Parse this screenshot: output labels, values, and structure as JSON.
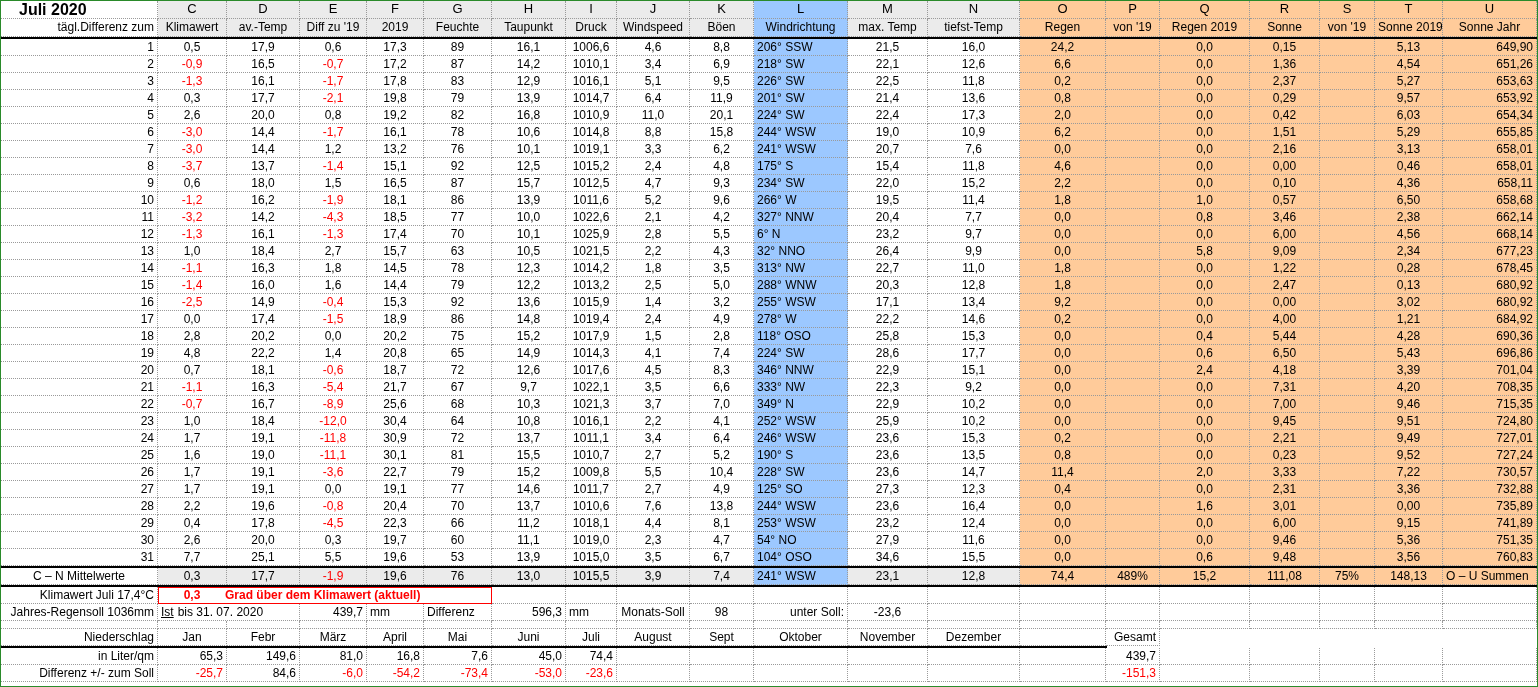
{
  "title": "Juli 2020",
  "column_letters": [
    "C",
    "D",
    "E",
    "F",
    "G",
    "H",
    "I",
    "J",
    "K",
    "L",
    "M",
    "N",
    "O",
    "P",
    "Q",
    "R",
    "S",
    "T",
    "U"
  ],
  "row_header_label": "tägl.Differenz zum",
  "column_headers": [
    "Klimawert",
    "av.-Temp",
    "Diff zu '19",
    "2019",
    "Feuchte",
    "Taupunkt",
    "Druck",
    "Windspeed",
    "Böen",
    "Windrichtung",
    "max. Temp",
    "tiefst-Temp",
    "Regen",
    "von '19",
    "Regen 2019",
    "Sonne",
    "von '19",
    "Sonne 2019",
    "Sonne Jahr"
  ],
  "rows": [
    {
      "day": "1",
      "cells": [
        "0,5",
        "17,9",
        "0,6",
        "17,3",
        "89",
        "16,1",
        "1006,6",
        "4,6",
        "8,8",
        "206° SSW",
        "21,5",
        "16,0",
        "24,2",
        null,
        "0,0",
        "0,15",
        null,
        "5,13",
        "649,90"
      ],
      "red_c": false,
      "red_e": false
    },
    {
      "day": "2",
      "cells": [
        "-0,9",
        "16,5",
        "-0,7",
        "17,2",
        "87",
        "14,2",
        "1010,1",
        "3,4",
        "6,9",
        "218° SW",
        "22,1",
        "12,6",
        "6,6",
        null,
        "0,0",
        "1,36",
        null,
        "4,54",
        "651,26"
      ],
      "red_c": true,
      "red_e": true
    },
    {
      "day": "3",
      "cells": [
        "-1,3",
        "16,1",
        "-1,7",
        "17,8",
        "83",
        "12,9",
        "1016,1",
        "5,1",
        "9,5",
        "226° SW",
        "22,5",
        "11,8",
        "0,2",
        null,
        "0,0",
        "2,37",
        null,
        "5,27",
        "653,63"
      ],
      "red_c": true,
      "red_e": true
    },
    {
      "day": "4",
      "cells": [
        "0,3",
        "17,7",
        "-2,1",
        "19,8",
        "79",
        "13,9",
        "1014,7",
        "6,4",
        "11,9",
        "201° SW",
        "21,4",
        "13,6",
        "0,8",
        null,
        "0,0",
        "0,29",
        null,
        "9,57",
        "653,92"
      ],
      "red_c": false,
      "red_e": true
    },
    {
      "day": "5",
      "cells": [
        "2,6",
        "20,0",
        "0,8",
        "19,2",
        "82",
        "16,8",
        "1010,9",
        "11,0",
        "20,1",
        "224° SW",
        "22,4",
        "17,3",
        "2,0",
        null,
        "0,0",
        "0,42",
        null,
        "6,03",
        "654,34"
      ],
      "red_c": false,
      "red_e": false
    },
    {
      "day": "6",
      "cells": [
        "-3,0",
        "14,4",
        "-1,7",
        "16,1",
        "78",
        "10,6",
        "1014,8",
        "8,8",
        "15,8",
        "244° WSW",
        "19,0",
        "10,9",
        "6,2",
        null,
        "0,0",
        "1,51",
        null,
        "5,29",
        "655,85"
      ],
      "red_c": true,
      "red_e": true
    },
    {
      "day": "7",
      "cells": [
        "-3,0",
        "14,4",
        "1,2",
        "13,2",
        "76",
        "10,1",
        "1019,1",
        "3,3",
        "6,2",
        "241° WSW",
        "20,7",
        "7,6",
        "0,0",
        null,
        "0,0",
        "2,16",
        null,
        "3,13",
        "658,01"
      ],
      "red_c": true,
      "red_e": false
    },
    {
      "day": "8",
      "cells": [
        "-3,7",
        "13,7",
        "-1,4",
        "15,1",
        "92",
        "12,5",
        "1015,2",
        "2,4",
        "4,8",
        "175° S",
        "15,4",
        "11,8",
        "4,6",
        null,
        "0,0",
        "0,00",
        null,
        "0,46",
        "658,01"
      ],
      "red_c": true,
      "red_e": true
    },
    {
      "day": "9",
      "cells": [
        "0,6",
        "18,0",
        "1,5",
        "16,5",
        "87",
        "15,7",
        "1012,5",
        "4,7",
        "9,3",
        "234° SW",
        "22,0",
        "15,2",
        "2,2",
        null,
        "0,0",
        "0,10",
        null,
        "4,36",
        "658,11"
      ],
      "red_c": false,
      "red_e": false
    },
    {
      "day": "10",
      "cells": [
        "-1,2",
        "16,2",
        "-1,9",
        "18,1",
        "86",
        "13,9",
        "1011,6",
        "5,2",
        "9,6",
        "266° W",
        "19,5",
        "11,4",
        "1,8",
        null,
        "1,0",
        "0,57",
        null,
        "6,50",
        "658,68"
      ],
      "red_c": true,
      "red_e": true
    },
    {
      "day": "11",
      "cells": [
        "-3,2",
        "14,2",
        "-4,3",
        "18,5",
        "77",
        "10,0",
        "1022,6",
        "2,1",
        "4,2",
        "327° NNW",
        "20,4",
        "7,7",
        "0,0",
        null,
        "0,8",
        "3,46",
        null,
        "2,38",
        "662,14"
      ],
      "red_c": true,
      "red_e": true
    },
    {
      "day": "12",
      "cells": [
        "-1,3",
        "16,1",
        "-1,3",
        "17,4",
        "70",
        "10,1",
        "1025,9",
        "2,8",
        "5,5",
        "6° N",
        "23,2",
        "9,7",
        "0,0",
        null,
        "0,0",
        "6,00",
        null,
        "4,56",
        "668,14"
      ],
      "red_c": true,
      "red_e": true
    },
    {
      "day": "13",
      "cells": [
        "1,0",
        "18,4",
        "2,7",
        "15,7",
        "63",
        "10,5",
        "1021,5",
        "2,2",
        "4,3",
        "32° NNO",
        "26,4",
        "9,9",
        "0,0",
        null,
        "5,8",
        "9,09",
        null,
        "2,34",
        "677,23"
      ],
      "red_c": false,
      "red_e": false
    },
    {
      "day": "14",
      "cells": [
        "-1,1",
        "16,3",
        "1,8",
        "14,5",
        "78",
        "12,3",
        "1014,2",
        "1,8",
        "3,5",
        "313° NW",
        "22,7",
        "11,0",
        "1,8",
        null,
        "0,0",
        "1,22",
        null,
        "0,28",
        "678,45"
      ],
      "red_c": true,
      "red_e": false
    },
    {
      "day": "15",
      "cells": [
        "-1,4",
        "16,0",
        "1,6",
        "14,4",
        "79",
        "12,2",
        "1013,2",
        "2,5",
        "5,0",
        "288° WNW",
        "20,3",
        "12,8",
        "1,8",
        null,
        "0,0",
        "2,47",
        null,
        "0,13",
        "680,92"
      ],
      "red_c": true,
      "red_e": false
    },
    {
      "day": "16",
      "cells": [
        "-2,5",
        "14,9",
        "-0,4",
        "15,3",
        "92",
        "13,6",
        "1015,9",
        "1,4",
        "3,2",
        "255° WSW",
        "17,1",
        "13,4",
        "9,2",
        null,
        "0,0",
        "0,00",
        null,
        "3,02",
        "680,92"
      ],
      "red_c": true,
      "red_e": true
    },
    {
      "day": "17",
      "cells": [
        "0,0",
        "17,4",
        "-1,5",
        "18,9",
        "86",
        "14,8",
        "1019,4",
        "2,4",
        "4,9",
        "278° W",
        "22,2",
        "14,6",
        "0,2",
        null,
        "0,0",
        "4,00",
        null,
        "1,21",
        "684,92"
      ],
      "red_c": false,
      "red_e": true
    },
    {
      "day": "18",
      "cells": [
        "2,8",
        "20,2",
        "0,0",
        "20,2",
        "75",
        "15,2",
        "1017,9",
        "1,5",
        "2,8",
        "118° OSO",
        "25,8",
        "15,3",
        "0,0",
        null,
        "0,4",
        "5,44",
        null,
        "4,28",
        "690,36"
      ],
      "red_c": false,
      "red_e": false
    },
    {
      "day": "19",
      "cells": [
        "4,8",
        "22,2",
        "1,4",
        "20,8",
        "65",
        "14,9",
        "1014,3",
        "4,1",
        "7,4",
        "224° SW",
        "28,6",
        "17,7",
        "0,0",
        null,
        "0,6",
        "6,50",
        null,
        "5,43",
        "696,86"
      ],
      "red_c": false,
      "red_e": false
    },
    {
      "day": "20",
      "cells": [
        "0,7",
        "18,1",
        "-0,6",
        "18,7",
        "72",
        "12,6",
        "1017,6",
        "4,5",
        "8,3",
        "346° NNW",
        "22,9",
        "15,1",
        "0,0",
        null,
        "2,4",
        "4,18",
        null,
        "3,39",
        "701,04"
      ],
      "red_c": false,
      "red_e": true
    },
    {
      "day": "21",
      "cells": [
        "-1,1",
        "16,3",
        "-5,4",
        "21,7",
        "67",
        "9,7",
        "1022,1",
        "3,5",
        "6,6",
        "333° NW",
        "22,3",
        "9,2",
        "0,0",
        null,
        "0,0",
        "7,31",
        null,
        "4,20",
        "708,35"
      ],
      "red_c": true,
      "red_e": true
    },
    {
      "day": "22",
      "cells": [
        "-0,7",
        "16,7",
        "-8,9",
        "25,6",
        "68",
        "10,3",
        "1021,3",
        "3,7",
        "7,0",
        "349° N",
        "22,9",
        "10,2",
        "0,0",
        null,
        "0,0",
        "7,00",
        null,
        "9,46",
        "715,35"
      ],
      "red_c": true,
      "red_e": true
    },
    {
      "day": "23",
      "cells": [
        "1,0",
        "18,4",
        "-12,0",
        "30,4",
        "64",
        "10,8",
        "1016,1",
        "2,2",
        "4,1",
        "252° WSW",
        "25,9",
        "10,2",
        "0,0",
        null,
        "0,0",
        "9,45",
        null,
        "9,51",
        "724,80"
      ],
      "red_c": false,
      "red_e": true
    },
    {
      "day": "24",
      "cells": [
        "1,7",
        "19,1",
        "-11,8",
        "30,9",
        "72",
        "13,7",
        "1011,1",
        "3,4",
        "6,4",
        "246° WSW",
        "23,6",
        "15,3",
        "0,2",
        null,
        "0,0",
        "2,21",
        null,
        "9,49",
        "727,01"
      ],
      "red_c": false,
      "red_e": true
    },
    {
      "day": "25",
      "cells": [
        "1,6",
        "19,0",
        "-11,1",
        "30,1",
        "81",
        "15,5",
        "1010,7",
        "2,7",
        "5,2",
        "190° S",
        "23,6",
        "13,5",
        "0,8",
        null,
        "0,0",
        "0,23",
        null,
        "9,52",
        "727,24"
      ],
      "red_c": false,
      "red_e": true
    },
    {
      "day": "26",
      "cells": [
        "1,7",
        "19,1",
        "-3,6",
        "22,7",
        "79",
        "15,2",
        "1009,8",
        "5,5",
        "10,4",
        "228° SW",
        "23,6",
        "14,7",
        "11,4",
        null,
        "2,0",
        "3,33",
        null,
        "7,22",
        "730,57"
      ],
      "red_c": false,
      "red_e": true
    },
    {
      "day": "27",
      "cells": [
        "1,7",
        "19,1",
        "0,0",
        "19,1",
        "77",
        "14,6",
        "1011,7",
        "2,7",
        "4,9",
        "125° SO",
        "27,3",
        "12,3",
        "0,4",
        null,
        "0,0",
        "2,31",
        null,
        "3,36",
        "732,88"
      ],
      "red_c": false,
      "red_e": false
    },
    {
      "day": "28",
      "cells": [
        "2,2",
        "19,6",
        "-0,8",
        "20,4",
        "70",
        "13,7",
        "1010,6",
        "7,6",
        "13,8",
        "244° WSW",
        "23,6",
        "16,4",
        "0,0",
        null,
        "1,6",
        "3,01",
        null,
        "0,00",
        "735,89"
      ],
      "red_c": false,
      "red_e": true
    },
    {
      "day": "29",
      "cells": [
        "0,4",
        "17,8",
        "-4,5",
        "22,3",
        "66",
        "11,2",
        "1018,1",
        "4,4",
        "8,1",
        "253° WSW",
        "23,2",
        "12,4",
        "0,0",
        null,
        "0,0",
        "6,00",
        null,
        "9,15",
        "741,89"
      ],
      "red_c": false,
      "red_e": true
    },
    {
      "day": "30",
      "cells": [
        "2,6",
        "20,0",
        "0,3",
        "19,7",
        "60",
        "11,1",
        "1019,0",
        "2,3",
        "4,7",
        "54° NO",
        "27,9",
        "11,6",
        "0,0",
        null,
        "0,0",
        "9,46",
        null,
        "5,36",
        "751,35"
      ],
      "red_c": false,
      "red_e": false
    },
    {
      "day": "31",
      "cells": [
        "7,7",
        "25,1",
        "5,5",
        "19,6",
        "53",
        "13,9",
        "1015,0",
        "3,5",
        "6,7",
        "104° OSO",
        "34,6",
        "15,5",
        "0,0",
        null,
        "0,6",
        "9,48",
        null,
        "3,56",
        "760,83"
      ],
      "red_c": false,
      "red_e": false
    }
  ],
  "averages": {
    "label": "C – N Mittelwerte",
    "cells": [
      "0,3",
      "17,7",
      "-1,9",
      "19,6",
      "76",
      "13,0",
      "1015,5",
      "3,9",
      "7,4",
      "241° WSW",
      "23,1",
      "12,8",
      "74,4",
      "489%",
      "15,2",
      "111,08",
      "75%",
      "148,13",
      "O – U Summen"
    ],
    "red_c": false,
    "red_e": true
  },
  "climate": {
    "label": "Klimawert Juli 17,4°C",
    "value": "0,3",
    "note": "Grad über dem Klimawert (aktuell)"
  },
  "rain_target": {
    "label": "Jahres-Regensoll 1036mm",
    "actual_label": "Ist",
    "date": "bis 31. 07. 2020",
    "actual": "439,7",
    "actual_unit": "mm",
    "difference_label": "Differenz",
    "difference": "596,3",
    "difference_unit": "mm",
    "monthly_label": "Monats-Soll",
    "monthly": "98",
    "below_label": "unter Soll:",
    "below": "-23,6"
  },
  "precipitation": {
    "label": "Niederschlag",
    "months": [
      "Jan",
      "Febr",
      "März",
      "April",
      "Mai",
      "Juni",
      "Juli",
      "August",
      "Sept",
      "Oktober",
      "November",
      "Dezember"
    ],
    "total_label": "Gesamt",
    "amount_label": "in Liter/qm",
    "amounts": [
      "65,3",
      "149,6",
      "81,0",
      "16,8",
      "7,6",
      "45,0",
      "74,4"
    ],
    "amount_total": "439,7",
    "diff_label": "Differenz  +/- zum Soll",
    "diffs": [
      {
        "value": "-25,7",
        "red": true
      },
      {
        "value": "84,6",
        "red": false
      },
      {
        "value": "-6,0",
        "red": true
      },
      {
        "value": "-54,2",
        "red": true
      },
      {
        "value": "-73,4",
        "red": true
      },
      {
        "value": "-53,0",
        "red": true
      },
      {
        "value": "-23,6",
        "red": true
      }
    ],
    "diff_total": {
      "value": "-151,3",
      "red": true
    }
  }
}
